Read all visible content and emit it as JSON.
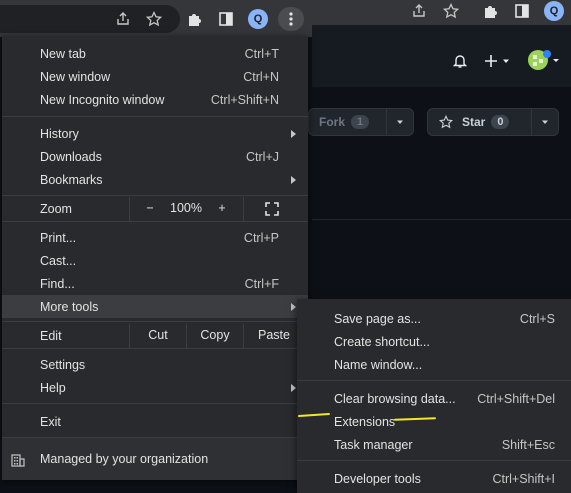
{
  "toolbar": {
    "profile_initial": "Q"
  },
  "github": {
    "fork_label": "Fork",
    "fork_count": "1",
    "star_label": "Star",
    "star_count": "0"
  },
  "menu": {
    "new_tab": {
      "label": "New tab",
      "shortcut": "Ctrl+T"
    },
    "new_window": {
      "label": "New window",
      "shortcut": "Ctrl+N"
    },
    "new_incognito": {
      "label": "New Incognito window",
      "shortcut": "Ctrl+Shift+N"
    },
    "history": {
      "label": "History"
    },
    "downloads": {
      "label": "Downloads",
      "shortcut": "Ctrl+J"
    },
    "bookmarks": {
      "label": "Bookmarks"
    },
    "zoom": {
      "label": "Zoom",
      "minus": "−",
      "value": "100%",
      "plus": "+"
    },
    "print": {
      "label": "Print...",
      "shortcut": "Ctrl+P"
    },
    "cast": {
      "label": "Cast..."
    },
    "find": {
      "label": "Find...",
      "shortcut": "Ctrl+F"
    },
    "more_tools": {
      "label": "More tools"
    },
    "edit": {
      "label": "Edit",
      "cut": "Cut",
      "copy": "Copy",
      "paste": "Paste"
    },
    "settings": {
      "label": "Settings"
    },
    "help": {
      "label": "Help"
    },
    "exit": {
      "label": "Exit"
    },
    "managed": {
      "label": "Managed by your organization"
    }
  },
  "submenu": {
    "save_page": {
      "label": "Save page as...",
      "shortcut": "Ctrl+S"
    },
    "create_shortcut": {
      "label": "Create shortcut..."
    },
    "name_window": {
      "label": "Name window..."
    },
    "clear_data": {
      "label": "Clear browsing data...",
      "shortcut": "Ctrl+Shift+Del"
    },
    "extensions": {
      "label": "Extensions"
    },
    "task_manager": {
      "label": "Task manager",
      "shortcut": "Shift+Esc"
    },
    "dev_tools": {
      "label": "Developer tools",
      "shortcut": "Ctrl+Shift+I"
    }
  },
  "colors": {
    "menu_bg": "#292a2d",
    "highlight": "#3c3d40",
    "annotation": "#f5e52b",
    "page_bg": "#0d1117"
  }
}
